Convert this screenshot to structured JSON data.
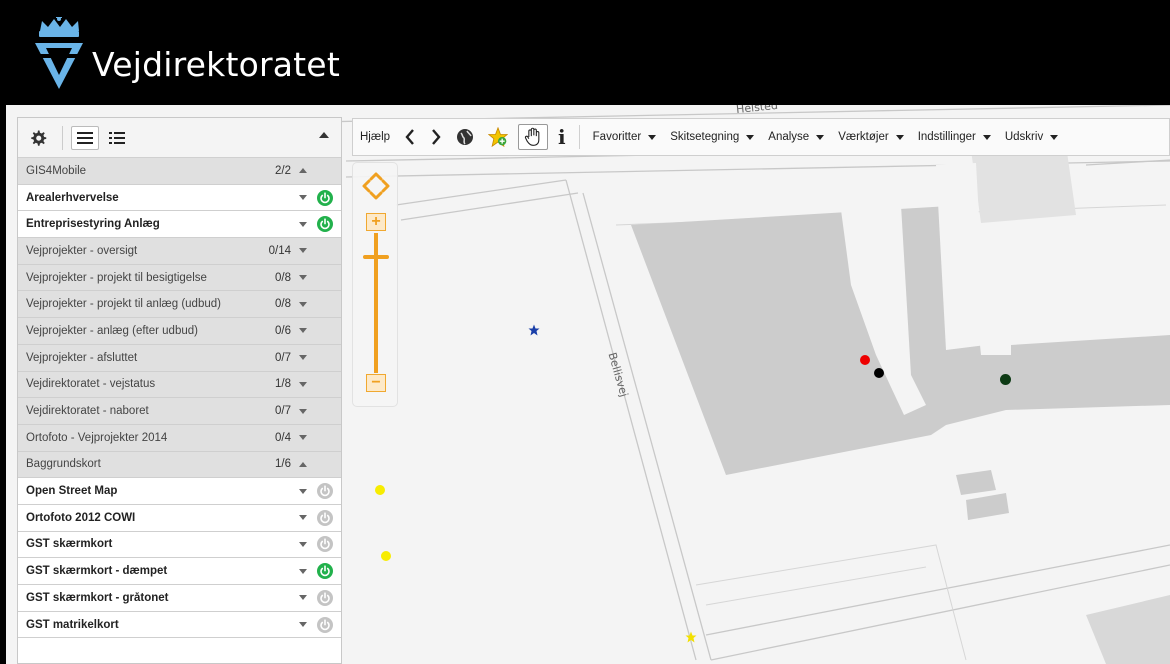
{
  "header": {
    "brand": "Vejdirektoratet"
  },
  "panel": {
    "rows": [
      {
        "name": "GIS4Mobile",
        "count": "2/2",
        "type": "group",
        "expanded": true
      },
      {
        "name": "Arealerhvervelse",
        "count": "",
        "type": "layer",
        "power": "on"
      },
      {
        "name": "Entreprisestyring Anlæg",
        "count": "",
        "type": "layer",
        "power": "on"
      },
      {
        "name": "Vejprojekter - oversigt",
        "count": "0/14",
        "type": "group",
        "expanded": false
      },
      {
        "name": "Vejprojekter - projekt til besigtigelse",
        "count": "0/8",
        "type": "group",
        "expanded": false
      },
      {
        "name": "Vejprojekter - projekt til anlæg (udbud)",
        "count": "0/8",
        "type": "group",
        "expanded": false
      },
      {
        "name": "Vejprojekter - anlæg (efter udbud)",
        "count": "0/6",
        "type": "group",
        "expanded": false
      },
      {
        "name": "Vejprojekter - afsluttet",
        "count": "0/7",
        "type": "group",
        "expanded": false
      },
      {
        "name": "Vejdirektoratet - vejstatus",
        "count": "1/8",
        "type": "group",
        "expanded": false
      },
      {
        "name": "Vejdirektoratet - naboret",
        "count": "0/7",
        "type": "group",
        "expanded": false
      },
      {
        "name": "Ortofoto - Vejprojekter 2014",
        "count": "0/4",
        "type": "group",
        "expanded": false
      },
      {
        "name": "Baggrundskort",
        "count": "1/6",
        "type": "group",
        "expanded": true
      },
      {
        "name": "Open Street Map",
        "count": "",
        "type": "layer",
        "power": "off"
      },
      {
        "name": "Ortofoto 2012 COWI",
        "count": "",
        "type": "layer",
        "power": "off"
      },
      {
        "name": "GST skærmkort",
        "count": "",
        "type": "layer",
        "power": "off"
      },
      {
        "name": "GST skærmkort - dæmpet",
        "count": "",
        "type": "layer",
        "power": "on"
      },
      {
        "name": "GST skærmkort - gråtonet",
        "count": "",
        "type": "layer",
        "power": "off"
      },
      {
        "name": "GST matrikelkort",
        "count": "",
        "type": "layer",
        "power": "off"
      }
    ]
  },
  "toolbar": {
    "help": "Hjælp",
    "info": "i",
    "menus": [
      "Favoritter",
      "Skitsetegning",
      "Analyse",
      "Værktøjer",
      "Indstillinger",
      "Udskriv"
    ]
  },
  "map": {
    "street_labels": [
      "Bellisvej",
      "Helsted"
    ]
  },
  "colors": {
    "power_on": "#22b14c",
    "power_off": "#c4c4c4",
    "zoom_accent": "#f0a020",
    "header_bg": "#000000",
    "building": "#cccccc"
  }
}
